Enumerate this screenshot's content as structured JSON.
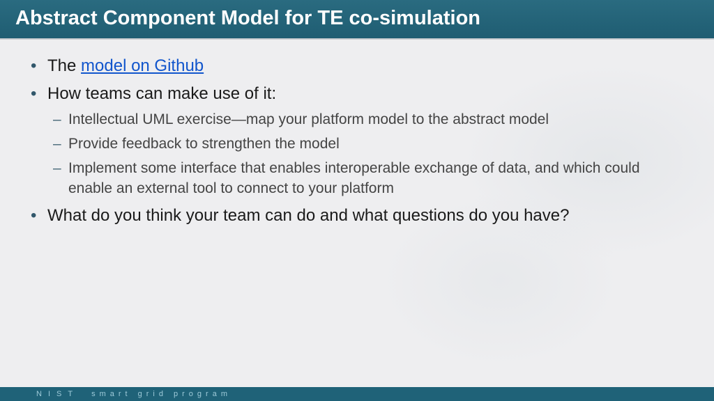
{
  "title": "Abstract Component Model for TE co-simulation",
  "bullets": {
    "b1_prefix": "The ",
    "b1_link": "model on Github",
    "b2": "How teams can make use of it:",
    "b2_sub": [
      "Intellectual UML exercise—map your platform model to the abstract model",
      "Provide feedback to strengthen the model",
      "Implement some interface that enables interoperable exchange of data, and which could enable an external tool to connect to your platform"
    ],
    "b3": "What do you think your team can do and what questions do you have?"
  },
  "footer": {
    "org": "NIST",
    "program": "smart grid program"
  }
}
